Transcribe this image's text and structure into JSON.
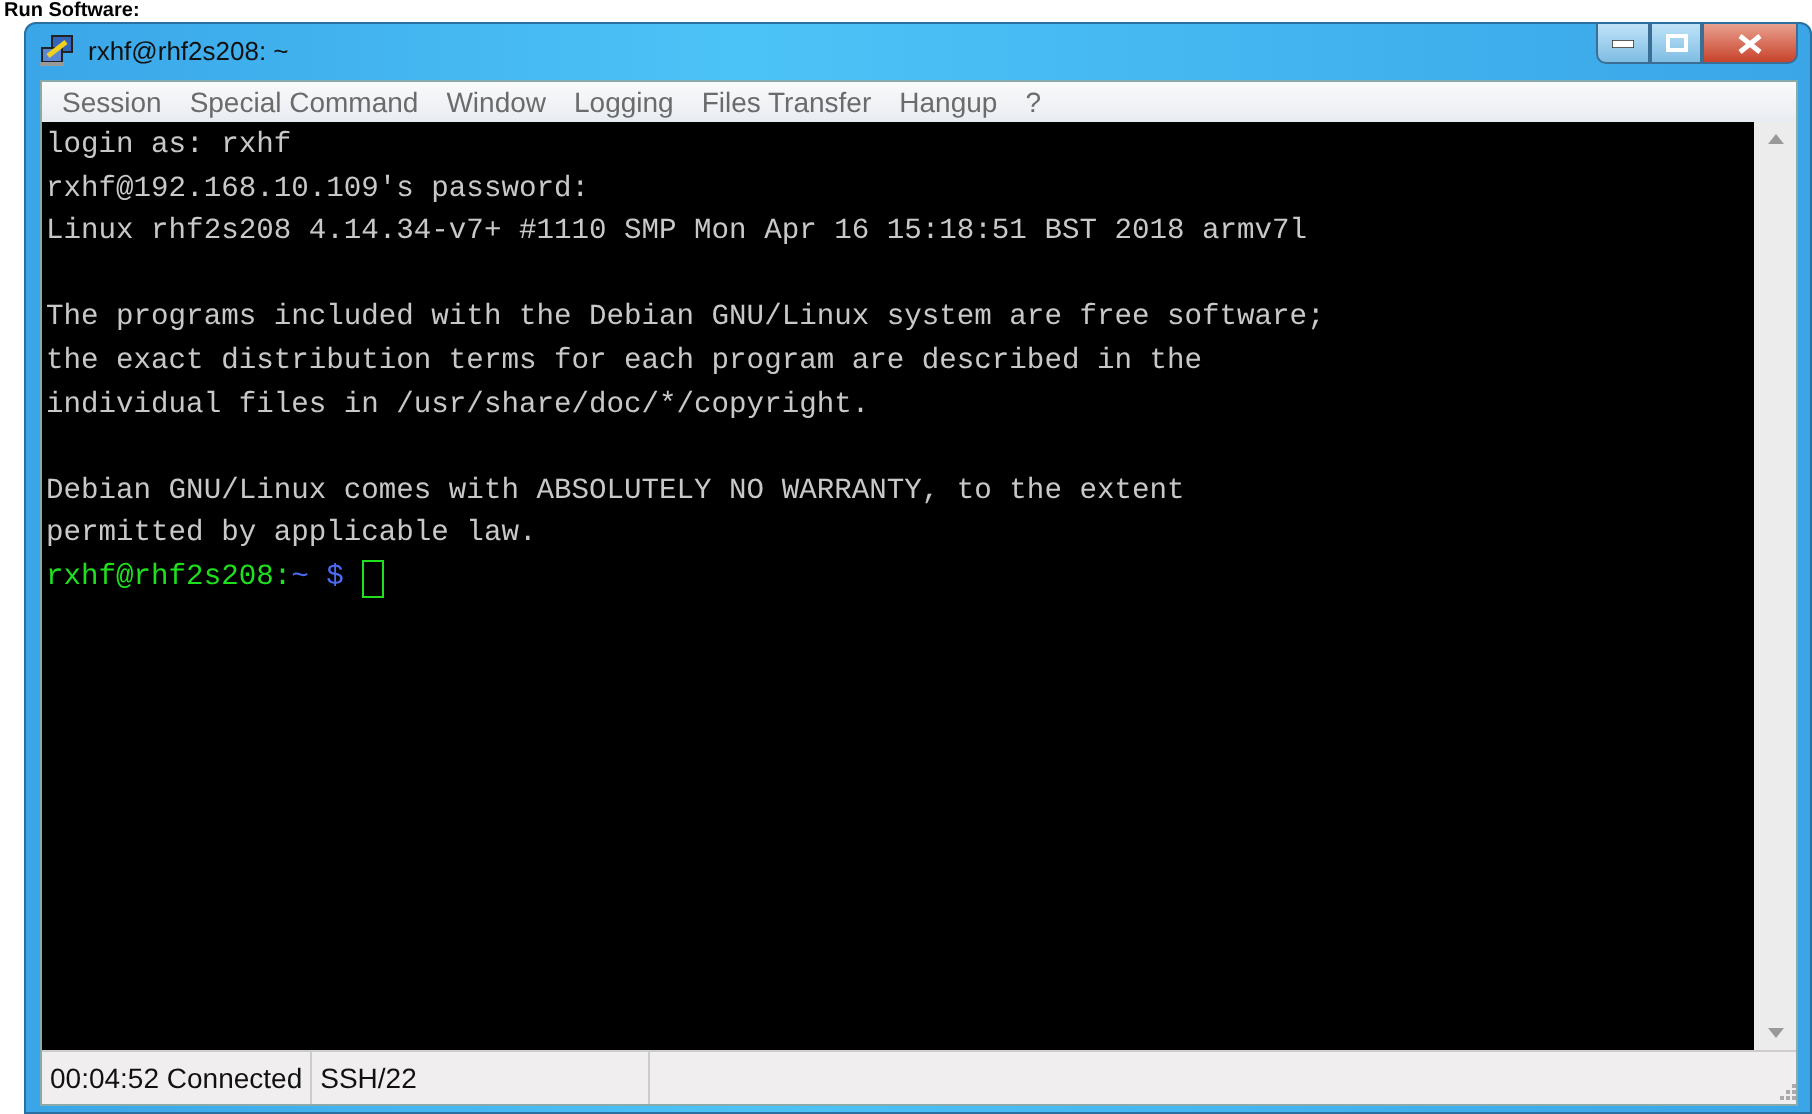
{
  "heading": "Run Software:",
  "window": {
    "title": "rxhf@rhf2s208: ~"
  },
  "menu": [
    {
      "label": "Session"
    },
    {
      "label": "Special Command"
    },
    {
      "label": "Window"
    },
    {
      "label": "Logging"
    },
    {
      "label": "Files Transfer"
    },
    {
      "label": "Hangup"
    },
    {
      "label": "?"
    }
  ],
  "terminal": {
    "lines": [
      {
        "kind": "text",
        "text": "login as: rxhf"
      },
      {
        "kind": "text",
        "text": "rxhf@192.168.10.109's password:"
      },
      {
        "kind": "text",
        "text": "Linux rhf2s208 4.14.34-v7+ #1110 SMP Mon Apr 16 15:18:51 BST 2018 armv7l"
      },
      {
        "kind": "blank"
      },
      {
        "kind": "text",
        "text": "The programs included with the Debian GNU/Linux system are free software;"
      },
      {
        "kind": "text",
        "text": "the exact distribution terms for each program are described in the"
      },
      {
        "kind": "text",
        "text": "individual files in /usr/share/doc/*/copyright."
      },
      {
        "kind": "blank"
      },
      {
        "kind": "text",
        "text": "Debian GNU/Linux comes with ABSOLUTELY NO WARRANTY, to the extent"
      },
      {
        "kind": "text",
        "text": "permitted by applicable law."
      },
      {
        "kind": "prompt",
        "user": "rxhf@rhf2s208:",
        "path": "~ $"
      }
    ]
  },
  "status_bar": [
    {
      "text": "00:04:52 Connected"
    },
    {
      "text": "SSH/22"
    }
  ]
}
